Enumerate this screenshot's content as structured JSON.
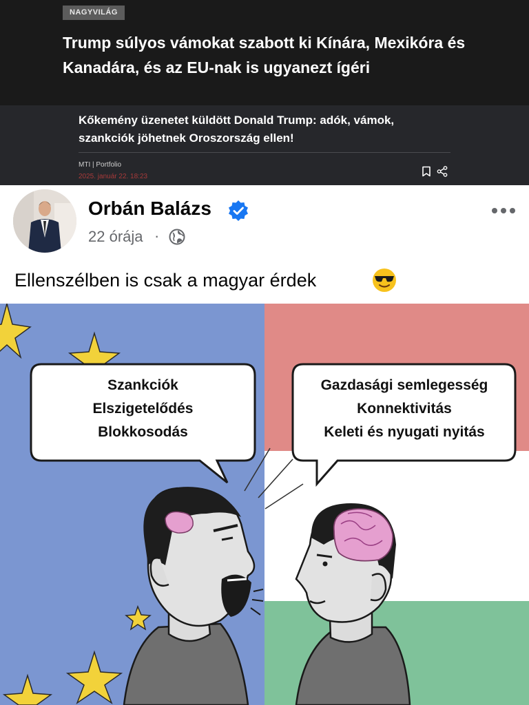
{
  "news": {
    "category": "NAGYVILÁG",
    "headline": "Trump súlyos vámokat szabott ki Kínára, Mexikóra és Kanadára, és az EU-nak is ugyanezt ígéri",
    "related_headline": "Kőkemény üzenetet küldött Donald Trump: adók, vámok, szankciók jöhetnek Oroszország ellen!",
    "source": "MTI  |  Portfolio",
    "date": "2025. január 22. 18:23",
    "actions": [
      "bookmark-icon",
      "share-icon"
    ]
  },
  "post": {
    "author": "Orbán Balázs",
    "verified": true,
    "time": "22 órája",
    "separator": "·",
    "audience_icon": "globe-icon",
    "menu_icon": "more-icon",
    "text": "Ellenszélben is csak a magyar érdek",
    "emoji": "smiling-face-with-sunglasses-icon"
  },
  "cartoon": {
    "left_bubble": [
      "Szankciók",
      "Elszigetelődés",
      "Blokkosodás"
    ],
    "right_bubble": [
      "Gazdasági semlegesség",
      "Konnektivitás",
      "Keleti és nyugati nyitás"
    ]
  },
  "colors": {
    "eu_blue": "#7b96d1",
    "star_yellow": "#f2d23a",
    "hu_red": "#e08a87",
    "hu_white": "#ffffff",
    "hu_green": "#7fc29a",
    "fb_blue": "#1877f2",
    "date_red": "#a83a3a"
  }
}
